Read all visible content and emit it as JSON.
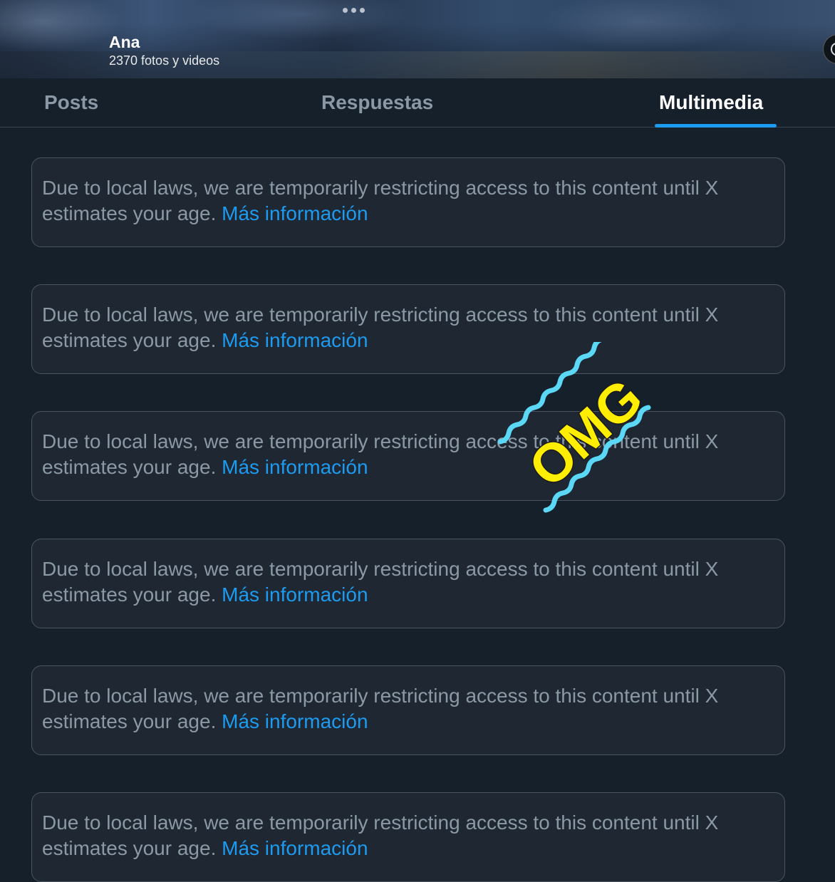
{
  "header": {
    "name": "Ana",
    "media_count": "2370 fotos y videos"
  },
  "tabs": [
    {
      "label": "Posts",
      "selected": false
    },
    {
      "label": "Respuestas",
      "selected": false
    },
    {
      "label": "Multimedia",
      "selected": true
    }
  ],
  "notices": [
    {
      "text": "Due to local laws, we are temporarily restricting access to this content until X estimates your age.",
      "link": "Más información"
    },
    {
      "text": "Due to local laws, we are temporarily restricting access to this content until X estimates your age.",
      "link": "Más información"
    },
    {
      "text": "Due to local laws, we are temporarily restricting access to this content until X estimates your age.",
      "link": "Más información"
    },
    {
      "text": "Due to local laws, we are temporarily restricting access to this content until X estimates your age.",
      "link": "Más información"
    },
    {
      "text": "Due to local laws, we are temporarily restricting access to this content until X estimates your age.",
      "link": "Más información"
    },
    {
      "text": "Due to local laws, we are temporarily restricting access to this content until X estimates your age.",
      "link": "Más información"
    }
  ],
  "sticker": {
    "text": "OMG",
    "text_color": "#ffee00",
    "wave_color": "#5ad8f5"
  },
  "colors": {
    "background": "#15202b",
    "accent": "#1d9bf0",
    "muted_text": "#8b98a5"
  }
}
